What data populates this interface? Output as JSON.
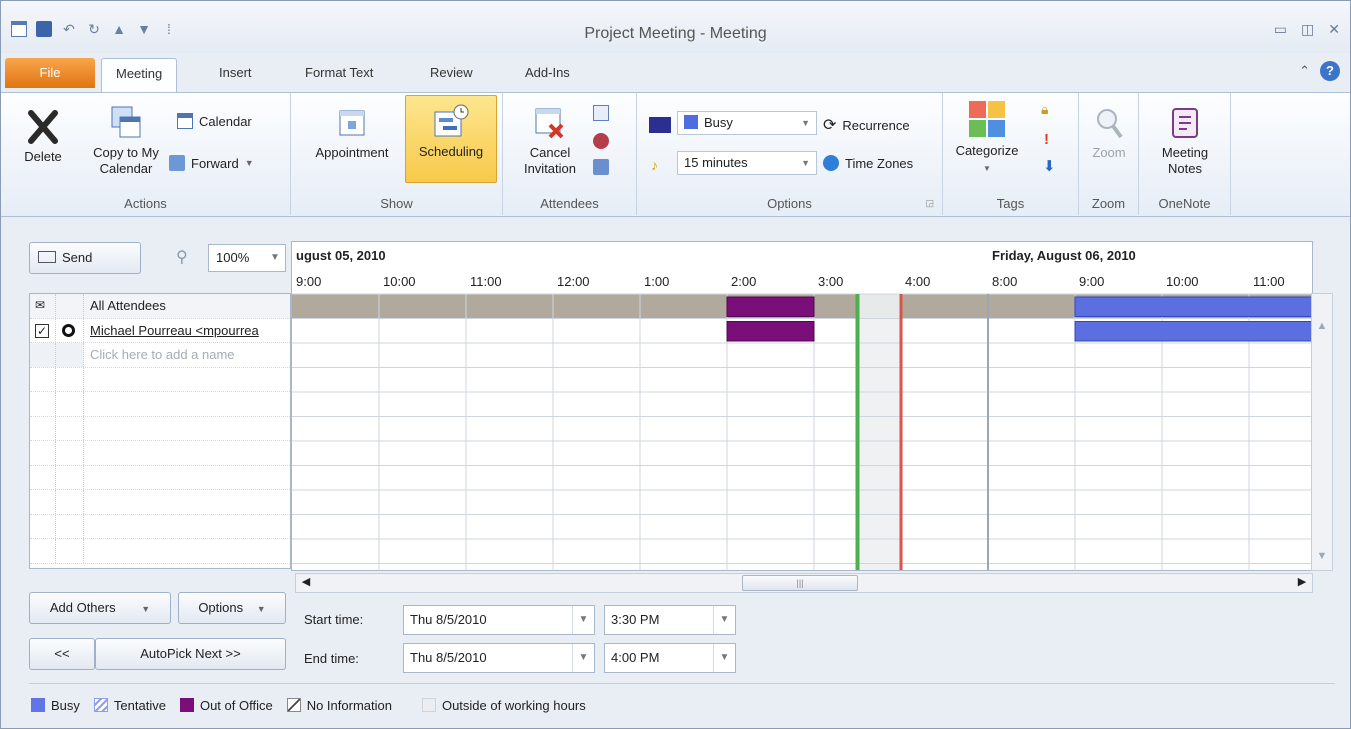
{
  "window": {
    "title": "Project Meeting - Meeting"
  },
  "tabs": [
    "File",
    "Meeting",
    "Insert",
    "Format Text",
    "Review",
    "Add-Ins"
  ],
  "ribbon": {
    "actions": {
      "label": "Actions",
      "delete": "Delete",
      "copy_line1": "Copy to My",
      "copy_line2": "Calendar",
      "calendar": "Calendar",
      "forward": "Forward"
    },
    "show": {
      "label": "Show",
      "appointment": "Appointment",
      "scheduling": "Scheduling"
    },
    "attendees": {
      "label": "Attendees",
      "cancel_line1": "Cancel",
      "cancel_line2": "Invitation"
    },
    "options": {
      "label": "Options",
      "show_as": "Busy",
      "reminder": "15 minutes",
      "recurrence": "Recurrence",
      "time_zones": "Time Zones"
    },
    "tags": {
      "label": "Tags",
      "categorize": "Categorize"
    },
    "zoom": {
      "label": "Zoom",
      "zoom": "Zoom"
    },
    "onenote": {
      "label": "OneNote",
      "notes_line1": "Meeting",
      "notes_line2": "Notes"
    }
  },
  "scheduler": {
    "send": "Send",
    "zoom": "100%",
    "attendees_header": "All Attendees",
    "attendees": [
      {
        "name": "Michael Pourreau <mpourrea",
        "checked": true
      }
    ],
    "add_name_placeholder": "Click here to add a name",
    "day1": "ugust 05, 2010",
    "day2": "Friday, August 06, 2010",
    "day1_hours": [
      "9:00",
      "10:00",
      "11:00",
      "12:00",
      "1:00",
      "2:00",
      "3:00",
      "4:00"
    ],
    "day2_hours": [
      "8:00",
      "9:00",
      "10:00",
      "11:00"
    ],
    "busy_blocks": [
      {
        "row": "all",
        "day": 1,
        "start": "2:00",
        "end": "3:00",
        "status": "Out of Office"
      },
      {
        "row": "attendee1",
        "day": 1,
        "start": "2:00",
        "end": "3:00",
        "status": "Out of Office"
      },
      {
        "row": "all",
        "day": 2,
        "start": "9:00",
        "end": "12:00",
        "status": "Busy"
      },
      {
        "row": "attendee1",
        "day": 2,
        "start": "9:00",
        "end": "12:00",
        "status": "Busy"
      }
    ],
    "selection": {
      "start": "3:30",
      "end": "4:00"
    }
  },
  "controls": {
    "add_others": "Add Others",
    "options": "Options",
    "prev": "<<",
    "autopick": "AutoPick Next >>",
    "start_label": "Start time:",
    "end_label": "End time:",
    "start_date": "Thu 8/5/2010",
    "start_time": "3:30 PM",
    "end_date": "Thu 8/5/2010",
    "end_time": "4:00 PM"
  },
  "legend": [
    "Busy",
    "Tentative",
    "Out of Office",
    "No Information",
    "Outside of working hours"
  ],
  "colors": {
    "busy": "#5b6fe0",
    "out_of_office": "#7a0f7a",
    "all_attendees_bar": "#b1aa9c",
    "start_line": "#4caf50",
    "end_line": "#d9534f"
  }
}
